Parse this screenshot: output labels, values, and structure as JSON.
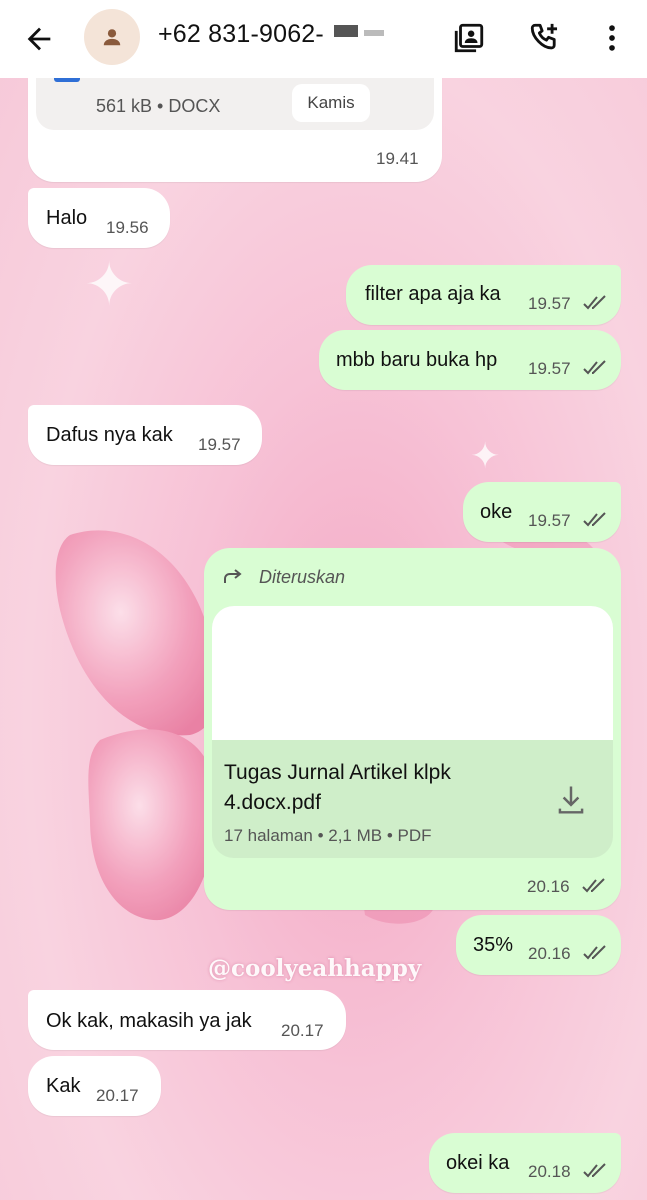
{
  "header": {
    "back_icon": "arrow-left-icon",
    "avatar_icon": "person-icon",
    "contact_number": "+62 831-9062-",
    "icons": [
      "contact-card-icon",
      "add-call-icon",
      "more-vert-icon"
    ]
  },
  "doc_card": {
    "meta": "561 kB • DOCX",
    "button": "Kamis",
    "time": "19.41"
  },
  "messages": [
    {
      "text": "Halo",
      "time": "19.56",
      "dir": "in"
    },
    {
      "text": "filter apa aja ka",
      "time": "19.57",
      "dir": "out"
    },
    {
      "text": "mbb baru buka hp",
      "time": "19.57",
      "dir": "out"
    },
    {
      "text": "Dafus nya kak",
      "time": "19.57",
      "dir": "in"
    },
    {
      "text": "oke",
      "time": "19.57",
      "dir": "out"
    },
    {
      "text": "35%",
      "time": "20.16",
      "dir": "out"
    },
    {
      "text": "Ok kak, makasih ya jak",
      "time": "20.17",
      "dir": "in"
    },
    {
      "text": "Kak",
      "time": "20.17",
      "dir": "in"
    },
    {
      "text": "okei ka",
      "time": "20.18",
      "dir": "out"
    }
  ],
  "forwarded": {
    "label": "Diteruskan",
    "file_name_line1": "Tugas Jurnal Artikel klpk",
    "file_name_line2": "4.docx.pdf",
    "meta": "17 halaman • 2,1 MB • PDF",
    "time": "20.16"
  },
  "watermark": "@coolyeahhappy",
  "colors": {
    "outgoing": "#d9fdd3",
    "incoming": "#ffffff",
    "tick": "#555555"
  }
}
